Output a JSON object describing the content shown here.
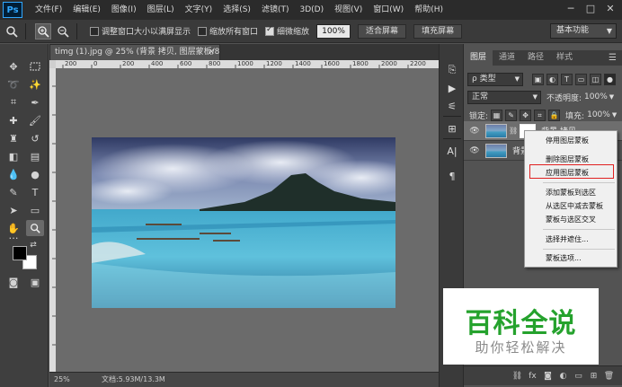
{
  "app": {
    "logo": "Ps"
  },
  "menu": [
    "文件(F)",
    "编辑(E)",
    "图像(I)",
    "图层(L)",
    "文字(Y)",
    "选择(S)",
    "滤镜(T)",
    "3D(D)",
    "视图(V)",
    "窗口(W)",
    "帮助(H)"
  ],
  "window_controls": {
    "minimize": "─",
    "maximize": "□",
    "close": "✕"
  },
  "options_bar": {
    "tool_icon": "zoom-icon",
    "zoom_in": "zoom-in-icon",
    "zoom_out": "zoom-out-icon",
    "resize_windows_label": "调整窗口大小以满屏显示",
    "resize_windows_checked": false,
    "zoom_all_label": "缩放所有窗口",
    "zoom_all_checked": false,
    "scrubby_zoom_label": "细微缩放",
    "scrubby_zoom_checked": true,
    "zoom_percent": "100%",
    "fit_screen_label": "适合屏幕",
    "fill_screen_label": "填充屏幕",
    "workspace": "基本功能"
  },
  "document": {
    "tab_title": "timg (1).jpg @ 25% (背景 拷贝, 图层蒙板/8) *",
    "tab_close": "×",
    "ruler_top": [
      "200",
      "0",
      "200",
      "400",
      "600",
      "800",
      "1000",
      "1200",
      "1400",
      "1600",
      "1800",
      "2000",
      "2200"
    ],
    "zoom": "25%",
    "doc_info": "文档:5.93M/13.3M"
  },
  "layers_panel": {
    "tabs": [
      "图层",
      "通道",
      "路径",
      "样式"
    ],
    "active_tab": 0,
    "filter_kind": "ρ 类型",
    "blend_mode": "正常",
    "opacity_label": "不透明度:",
    "opacity_value": "100%",
    "lock_label": "锁定:",
    "fill_label": "填充:",
    "fill_value": "100%",
    "layers": [
      {
        "name": "背景 拷贝",
        "visible": true,
        "selected": true,
        "has_mask": true
      },
      {
        "name": "背景",
        "visible": true,
        "selected": false,
        "has_mask": false
      }
    ]
  },
  "context_menu": {
    "items": [
      {
        "label": "停用图层蒙板"
      },
      {
        "label": "删除图层蒙板"
      },
      {
        "label": "应用图层蒙板",
        "highlighted": true
      },
      {
        "label": "添加蒙板到选区"
      },
      {
        "label": "从选区中减去蒙板"
      },
      {
        "label": "蒙板与选区交叉"
      },
      {
        "label": "选择并遮住..."
      },
      {
        "label": "蒙板选项..."
      }
    ],
    "highlight_color": "#e02020"
  },
  "watermark": {
    "title": "百科全说",
    "subtitle": "助你轻松解决",
    "title_color": "#25a22d",
    "subtitle_color": "#8a8a8a"
  },
  "colors": {
    "foreground": "#000000",
    "background": "#ffffff",
    "ps_blue": "#31a8ff"
  }
}
